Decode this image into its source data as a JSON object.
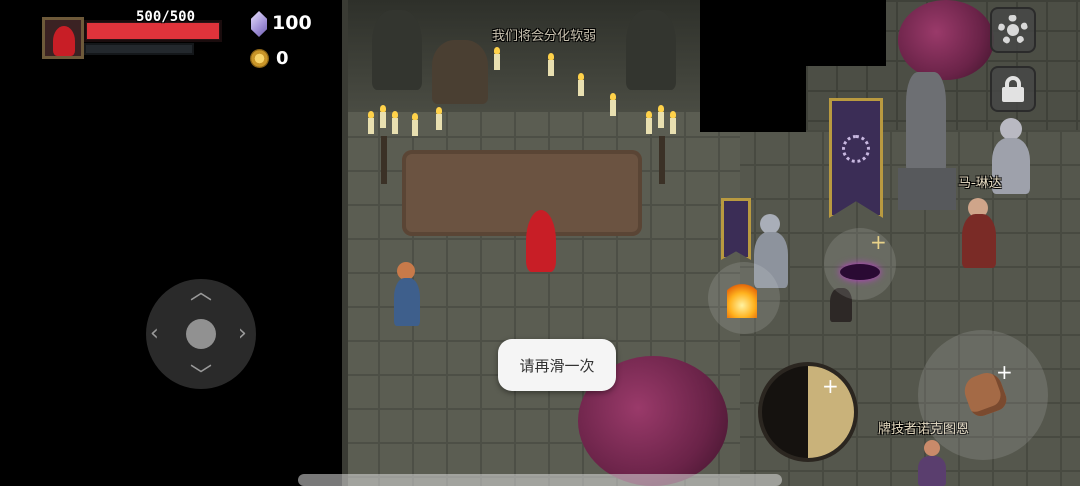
{
  "hud": {
    "hp_text": "500/500",
    "hp_fraction": 1.0,
    "gem_count": "100",
    "gold_count": "0"
  },
  "world_labels": {
    "sign_text": "我们将会分化软弱",
    "npc_malinda": "马-琳达",
    "npc_card_player": "牌技者诺克图恩"
  },
  "toast": {
    "message": "请再滑一次"
  },
  "controls": {
    "settings": "gear-icon",
    "lock": "lock-icon",
    "joystick": "dpad",
    "skill_cooldown_fraction": 0.5
  },
  "colors": {
    "hp": "#e0333b",
    "player_cloak": "#c81e26",
    "banner": "#3b2d56",
    "tree": "#8a2f5c"
  }
}
